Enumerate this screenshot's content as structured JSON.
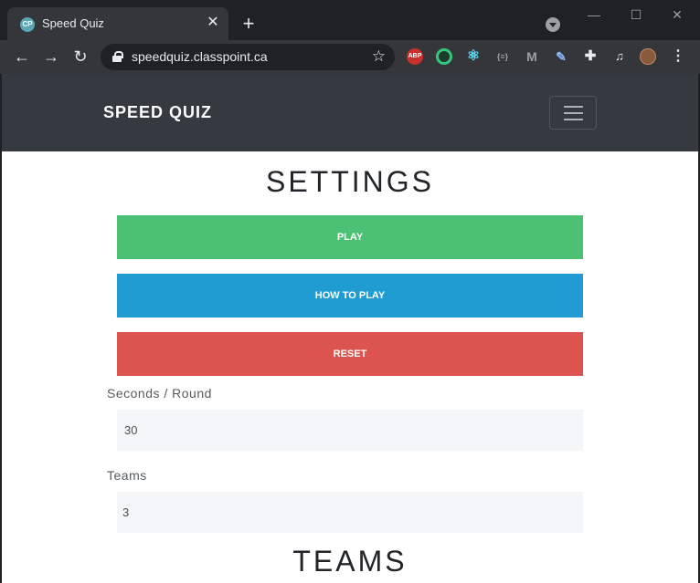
{
  "browser": {
    "tab_title": "Speed Quiz",
    "tab_favicon_text": "CP",
    "tab_close": "✕",
    "new_tab": "+",
    "url": "speedquiz.classpoint.ca",
    "nav": {
      "back": "←",
      "forward": "→",
      "reload": "↻"
    },
    "window_controls": {
      "minimize": "—",
      "maximize": "☐",
      "close": "✕"
    },
    "extensions": [
      "abp-icon",
      "extension-ring-icon",
      "react-devtools-icon",
      "extension-brackets-icon",
      "extension-m-icon",
      "extension-pen-icon",
      "extensions-puzzle-icon",
      "media-control-icon",
      "profile-avatar"
    ]
  },
  "app": {
    "brand": "SPEED QUIZ",
    "settings_heading": "SETTINGS",
    "buttons": {
      "play": "PLAY",
      "how_to_play": "HOW TO PLAY",
      "reset": "RESET"
    },
    "fields": {
      "seconds_label": "Seconds / Round",
      "seconds_value": "30",
      "teams_label": "Teams",
      "teams_value": "3"
    },
    "teams_heading": "TEAMS"
  },
  "colors": {
    "navbar": "#343a40",
    "play": "#4cc174",
    "how_to_play": "#209cd2",
    "reset": "#dc5450"
  }
}
